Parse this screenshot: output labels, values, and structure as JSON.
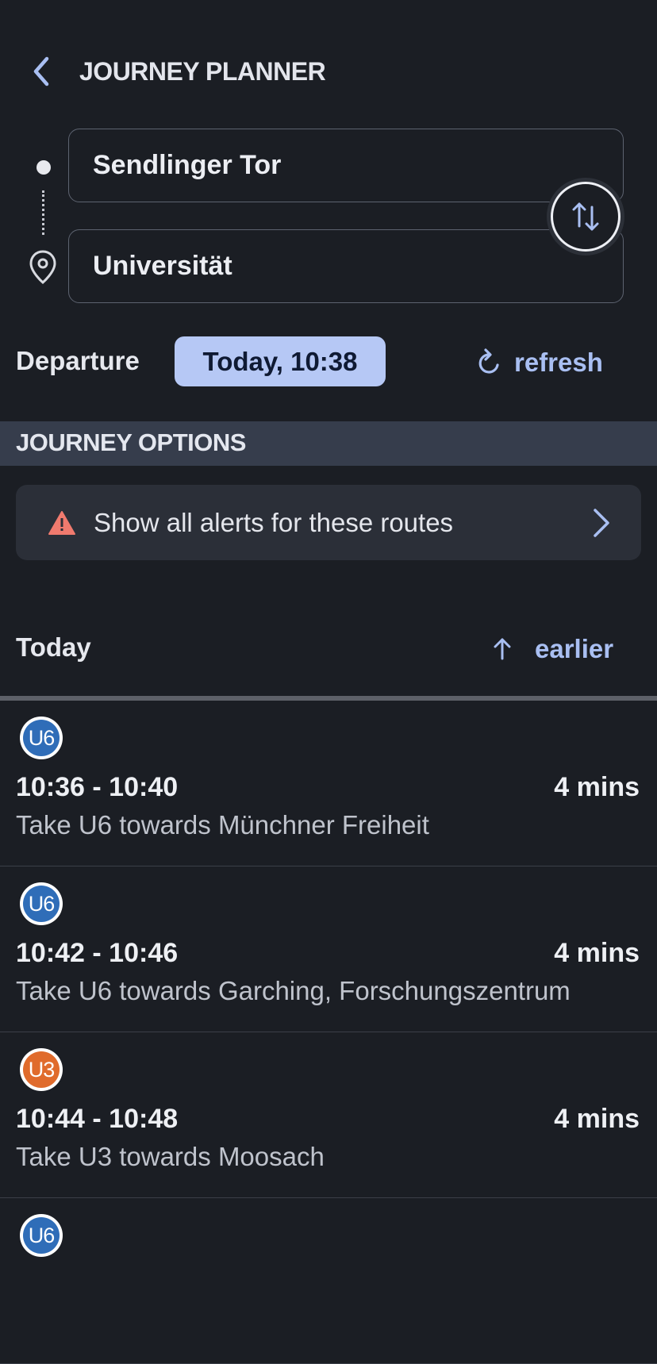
{
  "header": {
    "title": "JOURNEY PLANNER"
  },
  "route": {
    "from": "Sendlinger Tor",
    "to": "Universität"
  },
  "departure": {
    "label": "Departure",
    "value": "Today, 10:38",
    "refresh_label": "refresh"
  },
  "options": {
    "title": "JOURNEY OPTIONS",
    "alerts_label": "Show all alerts for these routes"
  },
  "list": {
    "day_label": "Today",
    "earlier_label": "earlier"
  },
  "colors": {
    "u6": "#2f6db8",
    "u3": "#e06b2c",
    "accent": "#a9bff2",
    "chip": "#b6c8f5",
    "alert": "#f07a6e"
  },
  "journeys": [
    {
      "line": "U6",
      "time": "10:36 - 10:40",
      "duration": "4 mins",
      "description": "Take U6 towards Münchner Freiheit"
    },
    {
      "line": "U6",
      "time": "10:42 - 10:46",
      "duration": "4 mins",
      "description": "Take U6 towards Garching, Forschungszentrum"
    },
    {
      "line": "U3",
      "time": "10:44 - 10:48",
      "duration": "4 mins",
      "description": "Take U3 towards Moosach"
    },
    {
      "line": "U6",
      "time": "",
      "duration": "",
      "description": ""
    }
  ]
}
